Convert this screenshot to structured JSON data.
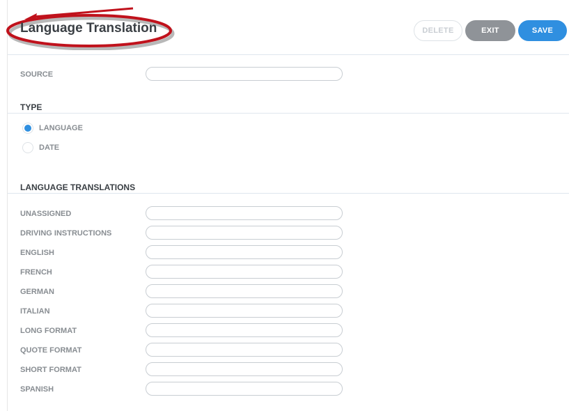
{
  "header": {
    "title": "Language Translation",
    "buttons": {
      "delete": "DELETE",
      "exit": "EXIT",
      "save": "SAVE"
    }
  },
  "source": {
    "label": "SOURCE",
    "value": ""
  },
  "type": {
    "title": "TYPE",
    "options": [
      {
        "label": "LANGUAGE",
        "selected": true
      },
      {
        "label": "DATE",
        "selected": false
      }
    ]
  },
  "translations": {
    "title": "LANGUAGE TRANSLATIONS",
    "rows": [
      {
        "label": "UNASSIGNED",
        "value": ""
      },
      {
        "label": "DRIVING INSTRUCTIONS",
        "value": ""
      },
      {
        "label": "ENGLISH",
        "value": ""
      },
      {
        "label": "FRENCH",
        "value": ""
      },
      {
        "label": "GERMAN",
        "value": ""
      },
      {
        "label": "ITALIAN",
        "value": ""
      },
      {
        "label": "LONG FORMAT",
        "value": ""
      },
      {
        "label": "QUOTE FORMAT",
        "value": ""
      },
      {
        "label": "SHORT FORMAT",
        "value": ""
      },
      {
        "label": "SPANISH",
        "value": ""
      }
    ]
  },
  "colors": {
    "accent": "#2f8fe0",
    "exit_button": "#8f9398",
    "annotation": "#c0121c"
  }
}
